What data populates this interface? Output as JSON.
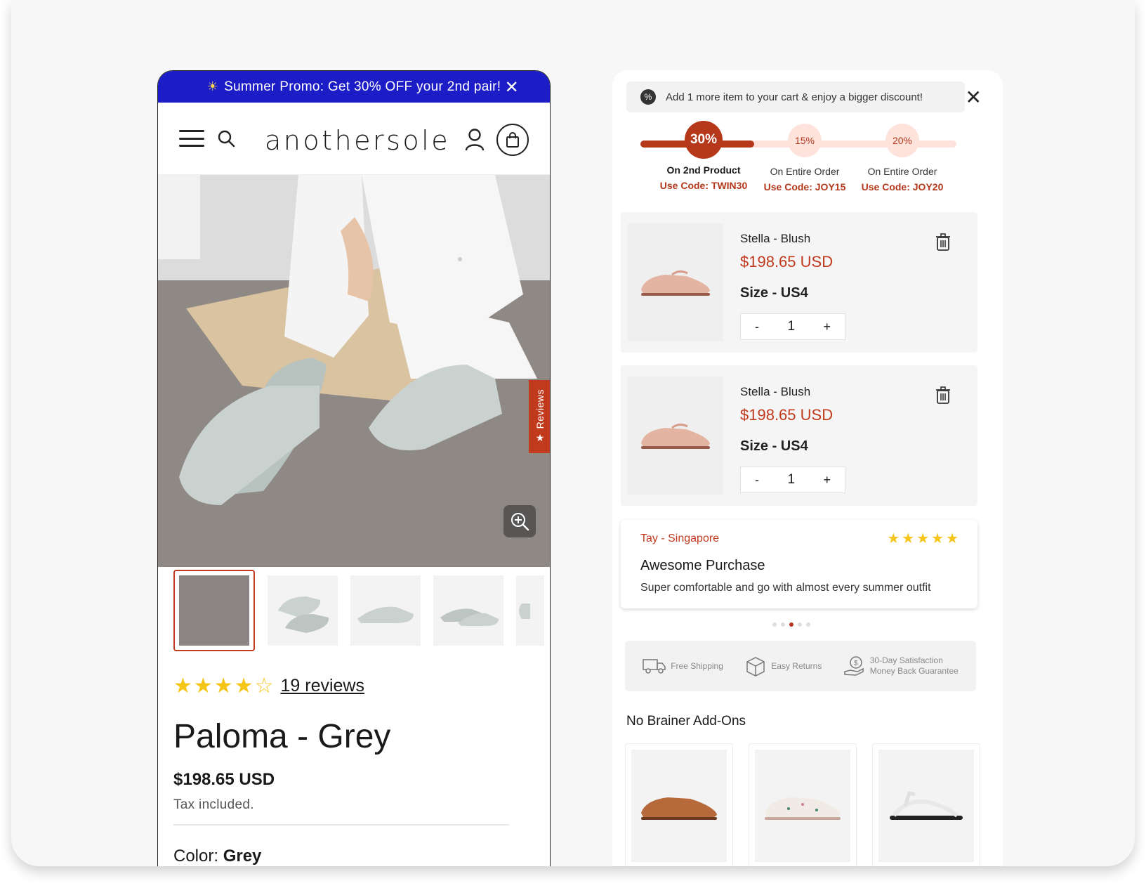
{
  "promo": {
    "icon": "sun-icon",
    "text": "Summer Promo: Get 30% OFF your 2nd pair!",
    "close": "✕"
  },
  "header": {
    "logo": "anothersole"
  },
  "hero": {
    "reviews_tab": "Reviews"
  },
  "product": {
    "rating": 4.5,
    "reviews_link": "19 reviews",
    "title": "Paloma - Grey",
    "price": "$198.65 USD",
    "tax": "Tax included.",
    "color_label": "Color:",
    "color_value": "Grey"
  },
  "cart": {
    "banner": "Add 1 more item to your cart & enjoy a bigger discount!",
    "close": "✕",
    "tiers": [
      {
        "percent": "30%",
        "name": "On 2nd Product",
        "code": "Use Code: TWIN30",
        "active": true
      },
      {
        "percent": "15%",
        "name": "On Entire Order",
        "code": "Use Code: JOY15",
        "active": false
      },
      {
        "percent": "20%",
        "name": "On Entire Order",
        "code": "Use Code: JOY20",
        "active": false
      }
    ],
    "progress_fraction": 0.36,
    "items": [
      {
        "name": "Stella - Blush",
        "price": "$198.65 USD",
        "size": "Size - US4",
        "qty": "1",
        "minus": "-",
        "plus": "+"
      },
      {
        "name": "Stella - Blush",
        "price": "$198.65 USD",
        "size": "Size - US4",
        "qty": "1",
        "minus": "-",
        "plus": "+"
      }
    ],
    "review": {
      "author": "Tay - Singapore",
      "rating": 5,
      "stars": "★★★★★",
      "title": "Awesome Purchase",
      "body": "Super comfortable and go with almost every summer outfit"
    },
    "carousel": {
      "count": 5,
      "active_index": 2
    },
    "trust": {
      "shipping": "Free Shipping",
      "returns": "Easy Returns",
      "guarantee_line1": "30-Day Satisfaction",
      "guarantee_line2": "Money Back Guarantee"
    },
    "addons_title": "No Brainer Add-Ons"
  },
  "colors": {
    "promo_bg": "#1d1dc7",
    "accent": "#b5381b",
    "star": "#f5c518"
  }
}
